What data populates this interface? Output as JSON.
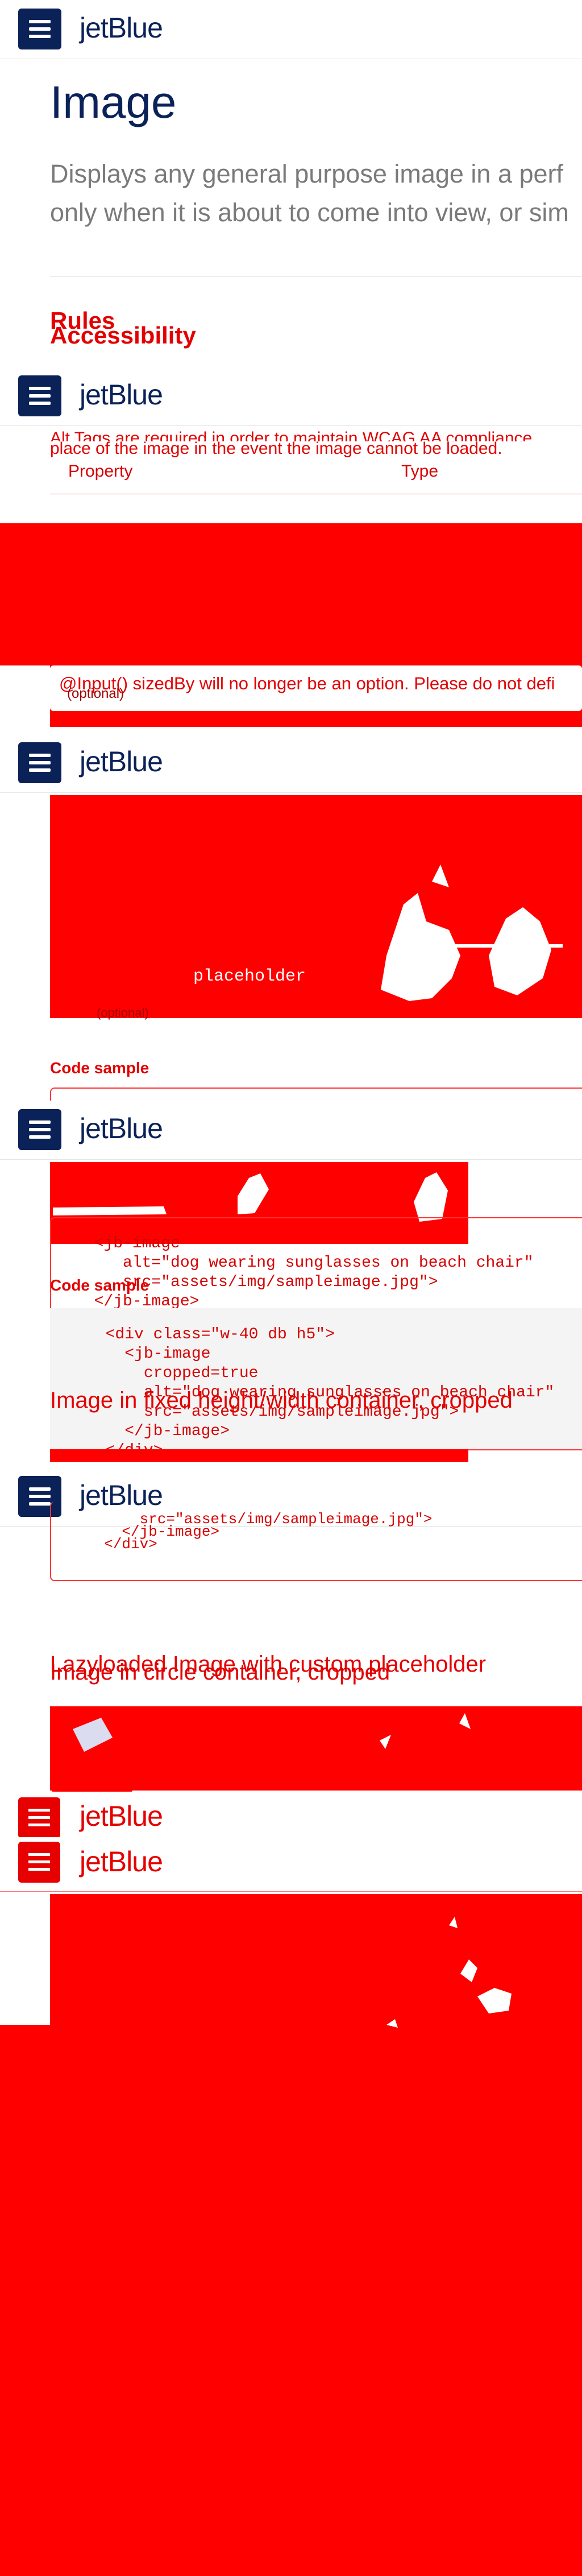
{
  "brand": {
    "name": "jetBlue"
  },
  "page": {
    "title": "Image",
    "description_line1": "Displays any general purpose image in a perf",
    "description_line2": "only when it is about to come into view, or sim"
  },
  "headings": {
    "rules": "Rules",
    "accessibility": "Accessibility",
    "code_sample": "Code sample",
    "fixed_container": "Image in fixed height/width container, cropped",
    "lazyloaded": "Lazyloaded Image with custom placeholder",
    "circle_container": "Image in circle container, cropped"
  },
  "accessibility": {
    "text_line1": "Alt Tags are required in order to maintain WCAG AA compliance",
    "text_line2": "place of the image in the event the image cannot be loaded."
  },
  "table": {
    "col_property": "Property",
    "col_type": "Type",
    "optional": "(optional)"
  },
  "notice": "@Input() sizedBy will no longer be an option. Please do not defi",
  "placeholder_label": "placeholder",
  "code_basic": "  <jb-image\n     alt=\"dog wearing sunglasses on beach chair\"\n     src=\"assets/img/sampleimage.jpg\">\n  </jb-image>",
  "code_container": "  <div class=\"w-40 db h5\">\n    <jb-image\n      cropped=true\n      alt=\"dog wearing sunglasses on beach chair\"\n      src=\"assets/img/sampleimage.jpg\">\n    </jb-image>\n  </div>",
  "code_tail": "      src=\"assets/img/sampleimage.jpg\">\n    </jb-image>\n  </div>",
  "colors": {
    "brand_navy": "#0b2259",
    "overlay_red": "#ff0000"
  }
}
